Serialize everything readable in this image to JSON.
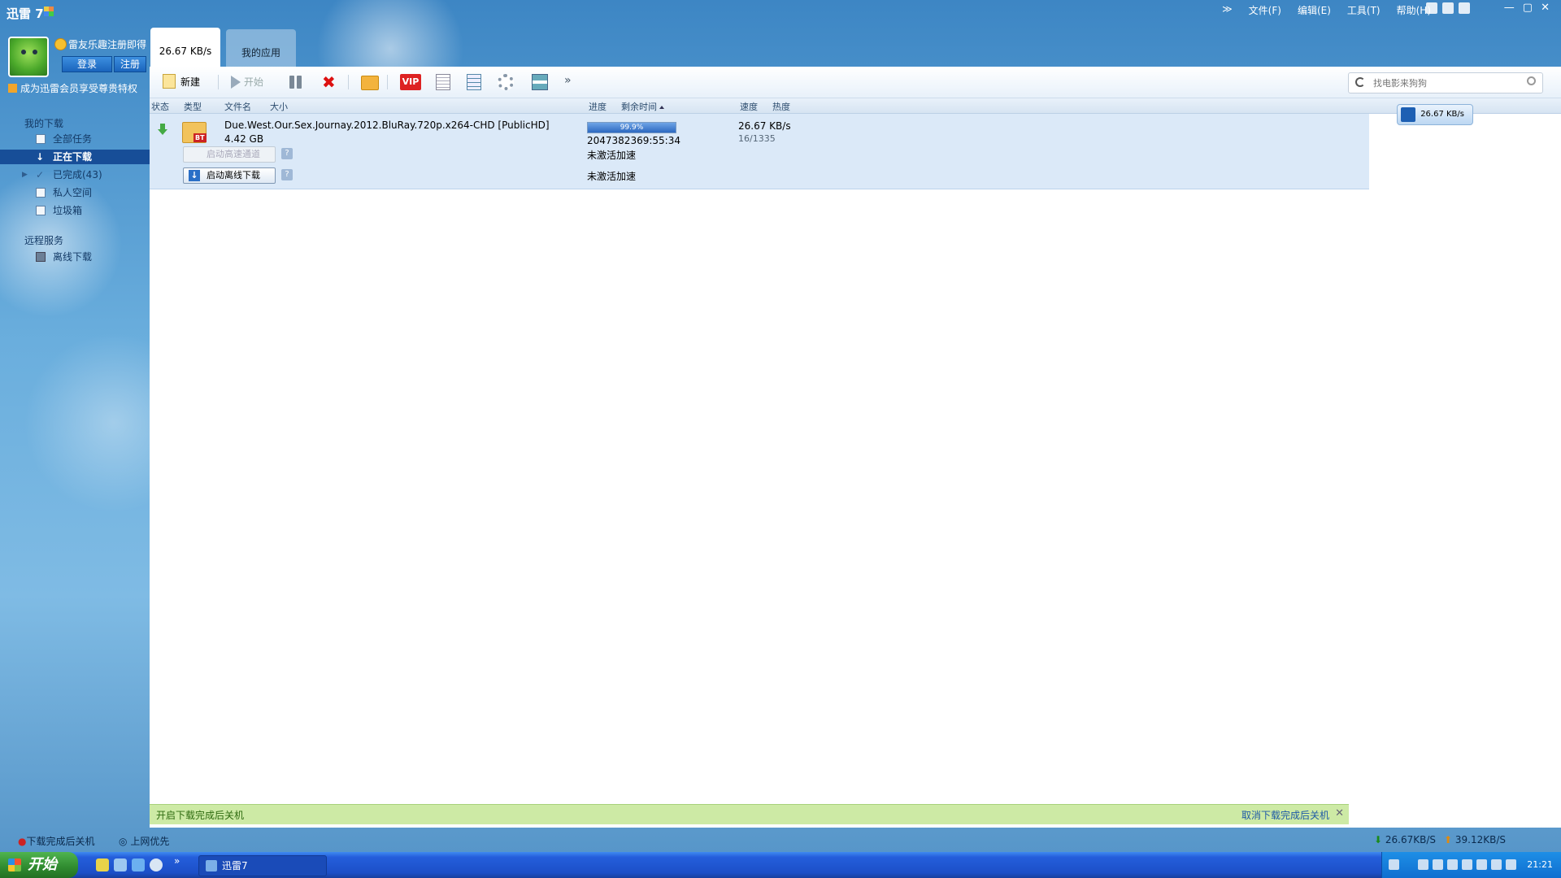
{
  "app": {
    "title": "迅雷 7",
    "menu": [
      "文件(F)",
      "编辑(E)",
      "工具(T)",
      "帮助(H)"
    ],
    "more_label": "≫",
    "window_buttons": [
      "—",
      "▢",
      "✕"
    ]
  },
  "user": {
    "promo": "雷友乐趣注册即得",
    "login_label": "登录",
    "register_label": "注册",
    "vip_promo": "成为迅雷会员享受尊贵特权"
  },
  "sidebar": {
    "section1": "我的下载",
    "items": [
      {
        "label": "全部任务"
      },
      {
        "label": "正在下载",
        "active": true
      },
      {
        "label": "已完成(43)"
      },
      {
        "label": "私人空间"
      },
      {
        "label": "垃圾箱"
      }
    ],
    "section2": "远程服务",
    "remote_items": [
      {
        "label": "离线下载"
      }
    ]
  },
  "tabs": [
    {
      "label": "26.67 KB/s",
      "active": true
    },
    {
      "label": "我的应用",
      "active": false
    }
  ],
  "toolbar": {
    "new_label": "新建",
    "start_label": "开始",
    "more_label": "»",
    "search_placeholder": "找电影来狗狗"
  },
  "columns": {
    "status": "状态",
    "type": "类型",
    "filename": "文件名",
    "size": "大小",
    "progress": "进度",
    "remaining": "剩余时间",
    "speed": "速度",
    "heat": "热度"
  },
  "task": {
    "filename": "Due.West.Our.Sex.Journay.2012.BluRay.720p.x264-CHD [PublicHD]",
    "size": "4.42 GB",
    "type_badge": "BT",
    "progress_text": "99.9%",
    "progress_value": 99.9,
    "remaining": "2047382369:55:34",
    "speed": "26.67 KB/s",
    "peers": "16/1335",
    "accel_button": "启动高速通道",
    "offline_button": "启动离线下载",
    "accel_status1": "未激活加速",
    "accel_status2": "未激活加速",
    "help": "?"
  },
  "float_speed": "26.67 KB/s",
  "notice": {
    "left": "开启下载完成后关机",
    "right": "取消下载完成后关机",
    "close": "✕"
  },
  "statusbar": {
    "shutdown": "下载完成后关机",
    "priority": "上网优先",
    "down_speed": "26.67KB/S",
    "up_speed": "39.12KB/S"
  },
  "taskbar": {
    "start_label": "开始",
    "more_label": "»",
    "window_label": "迅雷7",
    "clock": "21:21"
  }
}
